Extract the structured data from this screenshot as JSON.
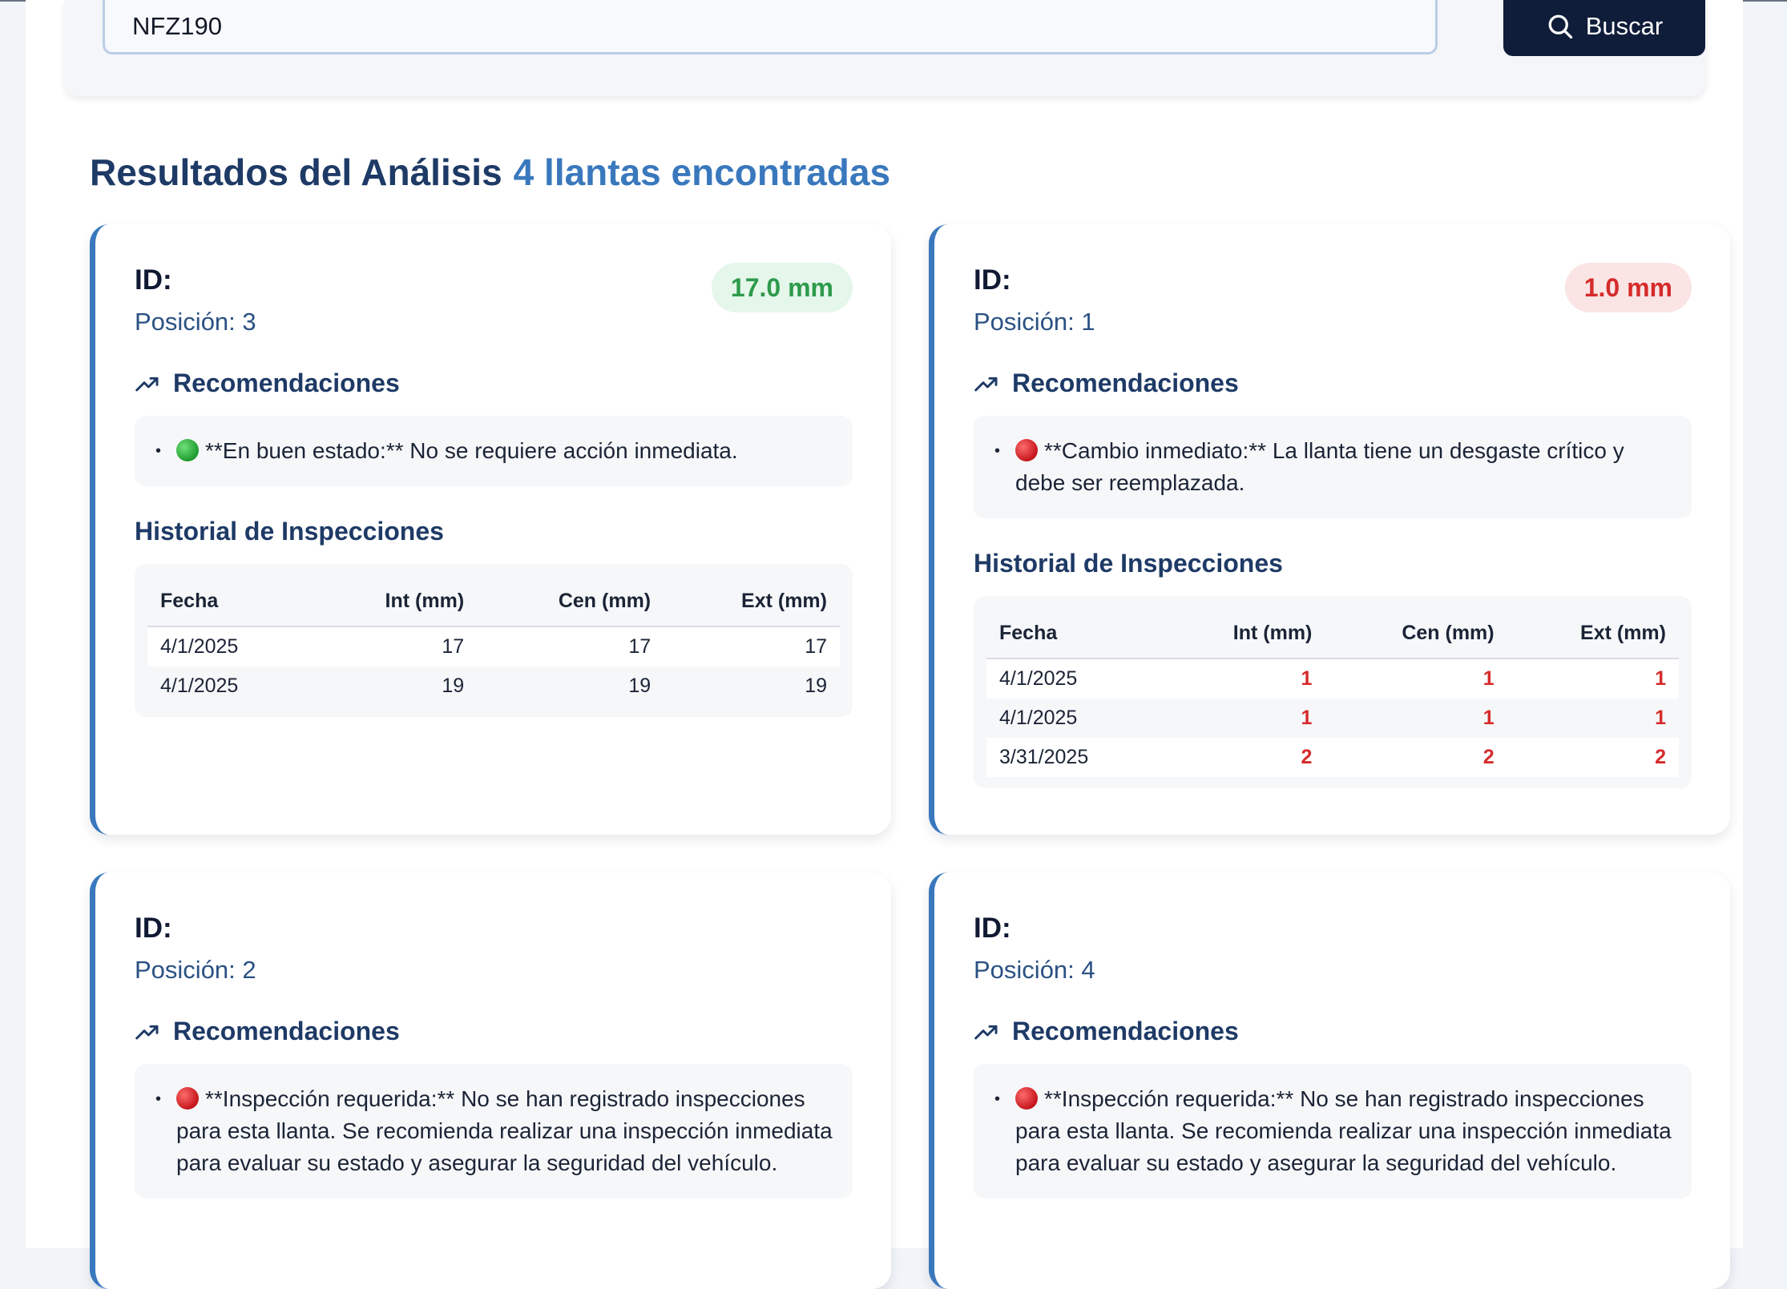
{
  "search": {
    "value": "NFZ190",
    "button_label": "Buscar"
  },
  "results": {
    "title": "Resultados del Análisis",
    "count_text": "4 llantas encontradas"
  },
  "colors": {
    "accent": "#3a78bd",
    "good": "#2e9a4c",
    "critical": "#d62b2b",
    "button": "#0f1d3a"
  },
  "cards": [
    {
      "id_label": "ID:",
      "position_label": "Posición: 3",
      "badge": "17.0 mm",
      "badge_status": "good",
      "recommendations_title": "Recomendaciones",
      "recommendation": "**En buen estado:** No se requiere acción inmediata.",
      "recommendation_icon": "green-circle-icon",
      "history_title": "Historial de Inspecciones",
      "table_headers": [
        "Fecha",
        "Int (mm)",
        "Cen (mm)",
        "Ext (mm)"
      ],
      "rows": [
        [
          "4/1/2025",
          "17",
          "17",
          "17"
        ],
        [
          "4/1/2025",
          "19",
          "19",
          "19"
        ]
      ]
    },
    {
      "id_label": "ID:",
      "position_label": "Posición: 1",
      "badge": "1.0 mm",
      "badge_status": "critical",
      "recommendations_title": "Recomendaciones",
      "recommendation": "**Cambio inmediato:** La llanta tiene un desgaste crítico y debe ser reemplazada.",
      "recommendation_icon": "red-circle-icon",
      "history_title": "Historial de Inspecciones",
      "table_headers": [
        "Fecha",
        "Int (mm)",
        "Cen (mm)",
        "Ext (mm)"
      ],
      "rows": [
        [
          "4/1/2025",
          "1",
          "1",
          "1"
        ],
        [
          "4/1/2025",
          "1",
          "1",
          "1"
        ],
        [
          "3/31/2025",
          "2",
          "2",
          "2"
        ]
      ]
    },
    {
      "id_label": "ID:",
      "position_label": "Posición: 2",
      "recommendations_title": "Recomendaciones",
      "recommendation": "**Inspección requerida:** No se han registrado inspecciones para esta llanta. Se recomienda realizar una inspección inmediata para evaluar su estado y asegurar la seguridad del vehículo.",
      "recommendation_icon": "red-circle-icon"
    },
    {
      "id_label": "ID:",
      "position_label": "Posición: 4",
      "recommendations_title": "Recomendaciones",
      "recommendation": "**Inspección requerida:** No se han registrado inspecciones para esta llanta. Se recomienda realizar una inspección inmediata para evaluar su estado y asegurar la seguridad del vehículo.",
      "recommendation_icon": "red-circle-icon"
    }
  ]
}
